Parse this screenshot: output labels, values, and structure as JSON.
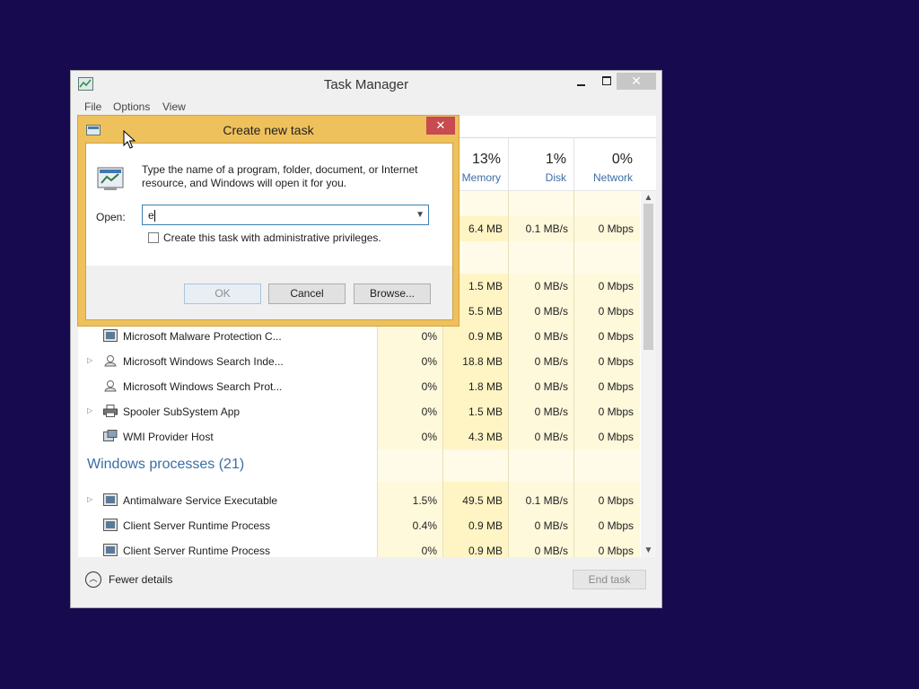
{
  "window": {
    "title": "Task Manager",
    "close_glyph": "✕",
    "menu": [
      "File",
      "Options",
      "View"
    ]
  },
  "columns": [
    {
      "pct": "13%",
      "label": "Memory"
    },
    {
      "pct": "1%",
      "label": "Disk"
    },
    {
      "pct": "0%",
      "label": "Network"
    }
  ],
  "rows": [
    {
      "mem": "6.4 MB",
      "disk": "0.1 MB/s",
      "net": "0 Mbps"
    },
    {
      "mem": "1.5 MB",
      "disk": "0 MB/s",
      "net": "0 Mbps"
    },
    {
      "mem": "5.5 MB",
      "disk": "0 MB/s",
      "net": "0 Mbps"
    },
    {
      "name": "Microsoft Malware Protection C...",
      "cpu": "0%",
      "mem": "0.9 MB",
      "disk": "0 MB/s",
      "net": "0 Mbps"
    },
    {
      "name": "Microsoft Windows Search Inde...",
      "cpu": "0%",
      "mem": "18.8 MB",
      "disk": "0 MB/s",
      "net": "0 Mbps"
    },
    {
      "name": "Microsoft Windows Search Prot...",
      "cpu": "0%",
      "mem": "1.8 MB",
      "disk": "0 MB/s",
      "net": "0 Mbps"
    },
    {
      "name": "Spooler SubSystem App",
      "cpu": "0%",
      "mem": "1.5 MB",
      "disk": "0 MB/s",
      "net": "0 Mbps"
    },
    {
      "name": "WMI Provider Host",
      "cpu": "0%",
      "mem": "4.3 MB",
      "disk": "0 MB/s",
      "net": "0 Mbps"
    },
    {
      "name": "Antimalware Service Executable",
      "cpu": "1.5%",
      "mem": "49.5 MB",
      "disk": "0.1 MB/s",
      "net": "0 Mbps"
    },
    {
      "name": "Client Server Runtime Process",
      "cpu": "0.4%",
      "mem": "0.9 MB",
      "disk": "0 MB/s",
      "net": "0 Mbps"
    },
    {
      "name": "Client Server Runtime Process",
      "cpu": "0%",
      "mem": "0.9 MB",
      "disk": "0 MB/s",
      "net": "0 Mbps"
    }
  ],
  "groups": {
    "windows_processes": "Windows processes (21)"
  },
  "footer": {
    "fewer_details": "Fewer details",
    "end_task": "End task"
  },
  "dialog": {
    "title": "Create new task",
    "close_glyph": "✕",
    "description": "Type the name of a program, folder, document, or Internet resource, and Windows will open it for you.",
    "open_label": "Open:",
    "open_value": "e",
    "admin_label": "Create this task with administrative privileges.",
    "admin_checked": false,
    "ok": "OK",
    "cancel": "Cancel",
    "browse": "Browse..."
  },
  "colors": {
    "desktop": "#180a4f",
    "heat_light": "#fff4c4",
    "heat_mid": "#fff0b3",
    "link_blue": "#3a6ea5",
    "dialog_frame": "#efc15c",
    "close_red": "#c74b50"
  },
  "icons": {
    "app": "task-manager-icon",
    "process": "process-window-icon",
    "search": "search-person-icon",
    "printer": "printer-icon",
    "wmi": "wmi-icon",
    "run": "run-dialog-icon",
    "cursor": "mouse-pointer-icon"
  }
}
